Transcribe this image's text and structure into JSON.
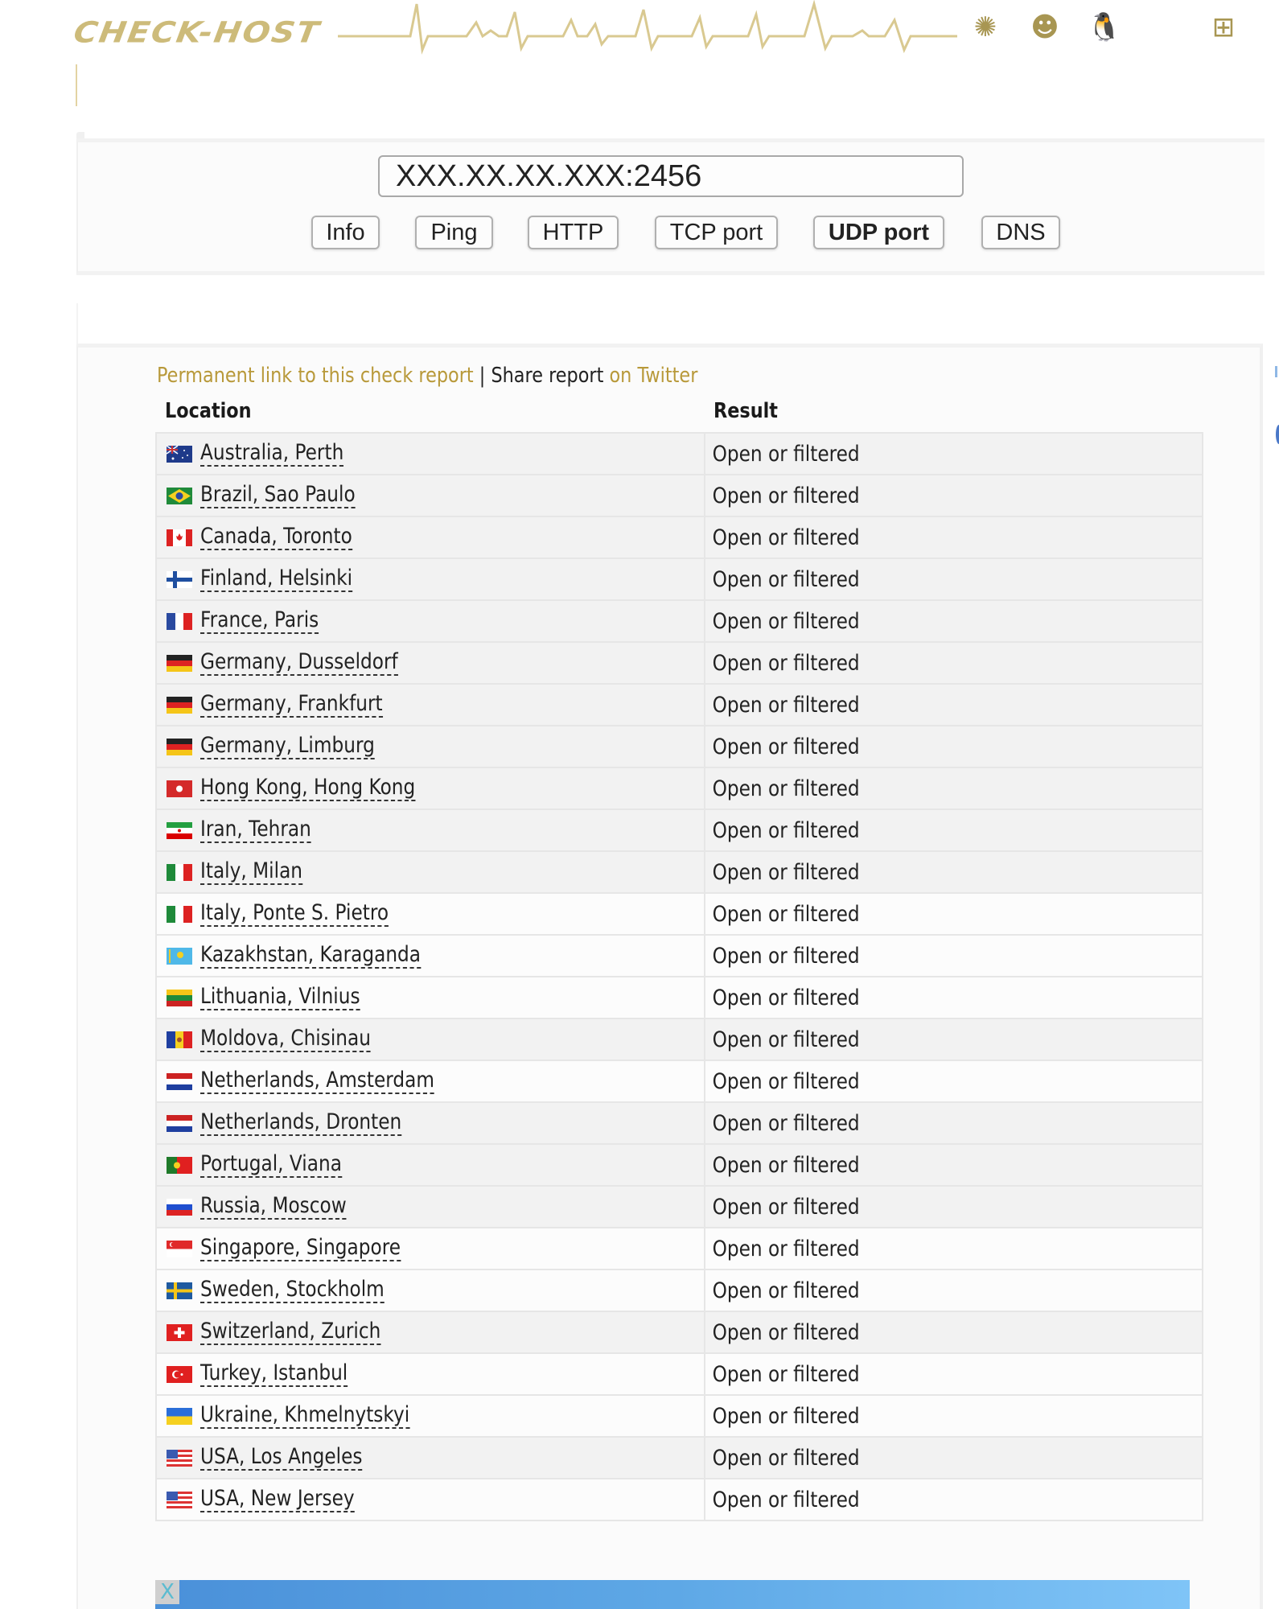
{
  "header": {
    "logo_text": "CHECK-HOST",
    "os_icons": [
      {
        "name": "openbsd-icon",
        "glyph": "✺"
      },
      {
        "name": "freebsd-icon",
        "glyph": "☻"
      },
      {
        "name": "linux-icon",
        "glyph": "🐧"
      },
      {
        "name": "apple-icon",
        "glyph": ""
      },
      {
        "name": "windows-icon",
        "glyph": "⊞"
      }
    ],
    "accent_color": "#cdbb7a"
  },
  "search": {
    "host_value": "XXX.XX.XX.XXX:2456",
    "buttons": [
      {
        "label": "Info",
        "active": false
      },
      {
        "label": "Ping",
        "active": false
      },
      {
        "label": "HTTP",
        "active": false
      },
      {
        "label": "TCP port",
        "active": false
      },
      {
        "label": "UDP port",
        "active": true
      },
      {
        "label": "DNS",
        "active": false
      }
    ]
  },
  "report": {
    "permanent_link": "Permanent link to this check report",
    "separator": " | ",
    "share_text": "Share report ",
    "twitter_link": "on Twitter",
    "link_color": "#b8993a",
    "columns": {
      "location": "Location",
      "result": "Result"
    },
    "rows": [
      {
        "location": "Australia, Perth",
        "flag": "au",
        "result": "Open or filtered",
        "shaded": true
      },
      {
        "location": "Brazil, Sao Paulo",
        "flag": "br",
        "result": "Open or filtered",
        "shaded": true
      },
      {
        "location": "Canada, Toronto",
        "flag": "ca",
        "result": "Open or filtered",
        "shaded": true
      },
      {
        "location": "Finland, Helsinki",
        "flag": "fi",
        "result": "Open or filtered",
        "shaded": true
      },
      {
        "location": "France, Paris",
        "flag": "fr",
        "result": "Open or filtered",
        "shaded": true
      },
      {
        "location": "Germany, Dusseldorf",
        "flag": "de",
        "result": "Open or filtered",
        "shaded": true
      },
      {
        "location": "Germany, Frankfurt",
        "flag": "de",
        "result": "Open or filtered",
        "shaded": true
      },
      {
        "location": "Germany, Limburg",
        "flag": "de",
        "result": "Open or filtered",
        "shaded": true
      },
      {
        "location": "Hong Kong, Hong Kong",
        "flag": "hk",
        "result": "Open or filtered",
        "shaded": true
      },
      {
        "location": "Iran, Tehran",
        "flag": "ir",
        "result": "Open or filtered",
        "shaded": true
      },
      {
        "location": "Italy, Milan",
        "flag": "it",
        "result": "Open or filtered",
        "shaded": true
      },
      {
        "location": "Italy, Ponte S. Pietro",
        "flag": "it",
        "result": "Open or filtered",
        "shaded": false
      },
      {
        "location": "Kazakhstan, Karaganda",
        "flag": "kz",
        "result": "Open or filtered",
        "shaded": false
      },
      {
        "location": "Lithuania, Vilnius",
        "flag": "lt",
        "result": "Open or filtered",
        "shaded": false
      },
      {
        "location": "Moldova, Chisinau",
        "flag": "md",
        "result": "Open or filtered",
        "shaded": true
      },
      {
        "location": "Netherlands, Amsterdam",
        "flag": "nl",
        "result": "Open or filtered",
        "shaded": false
      },
      {
        "location": "Netherlands, Dronten",
        "flag": "nl",
        "result": "Open or filtered",
        "shaded": true
      },
      {
        "location": "Portugal, Viana",
        "flag": "pt",
        "result": "Open or filtered",
        "shaded": true
      },
      {
        "location": "Russia, Moscow",
        "flag": "ru",
        "result": "Open or filtered",
        "shaded": true
      },
      {
        "location": "Singapore, Singapore",
        "flag": "sg",
        "result": "Open or filtered",
        "shaded": false
      },
      {
        "location": "Sweden, Stockholm",
        "flag": "se",
        "result": "Open or filtered",
        "shaded": false
      },
      {
        "location": "Switzerland, Zurich",
        "flag": "ch",
        "result": "Open or filtered",
        "shaded": true
      },
      {
        "location": "Turkey, Istanbul",
        "flag": "tr",
        "result": "Open or filtered",
        "shaded": false
      },
      {
        "location": "Ukraine, Khmelnytskyi",
        "flag": "ua",
        "result": "Open or filtered",
        "shaded": false
      },
      {
        "location": "USA, Los Angeles",
        "flag": "us",
        "result": "Open or filtered",
        "shaded": true
      },
      {
        "location": "USA, New Jersey",
        "flag": "us",
        "result": "Open or filtered",
        "shaded": false
      }
    ]
  },
  "ad": {
    "close_label": "X"
  }
}
